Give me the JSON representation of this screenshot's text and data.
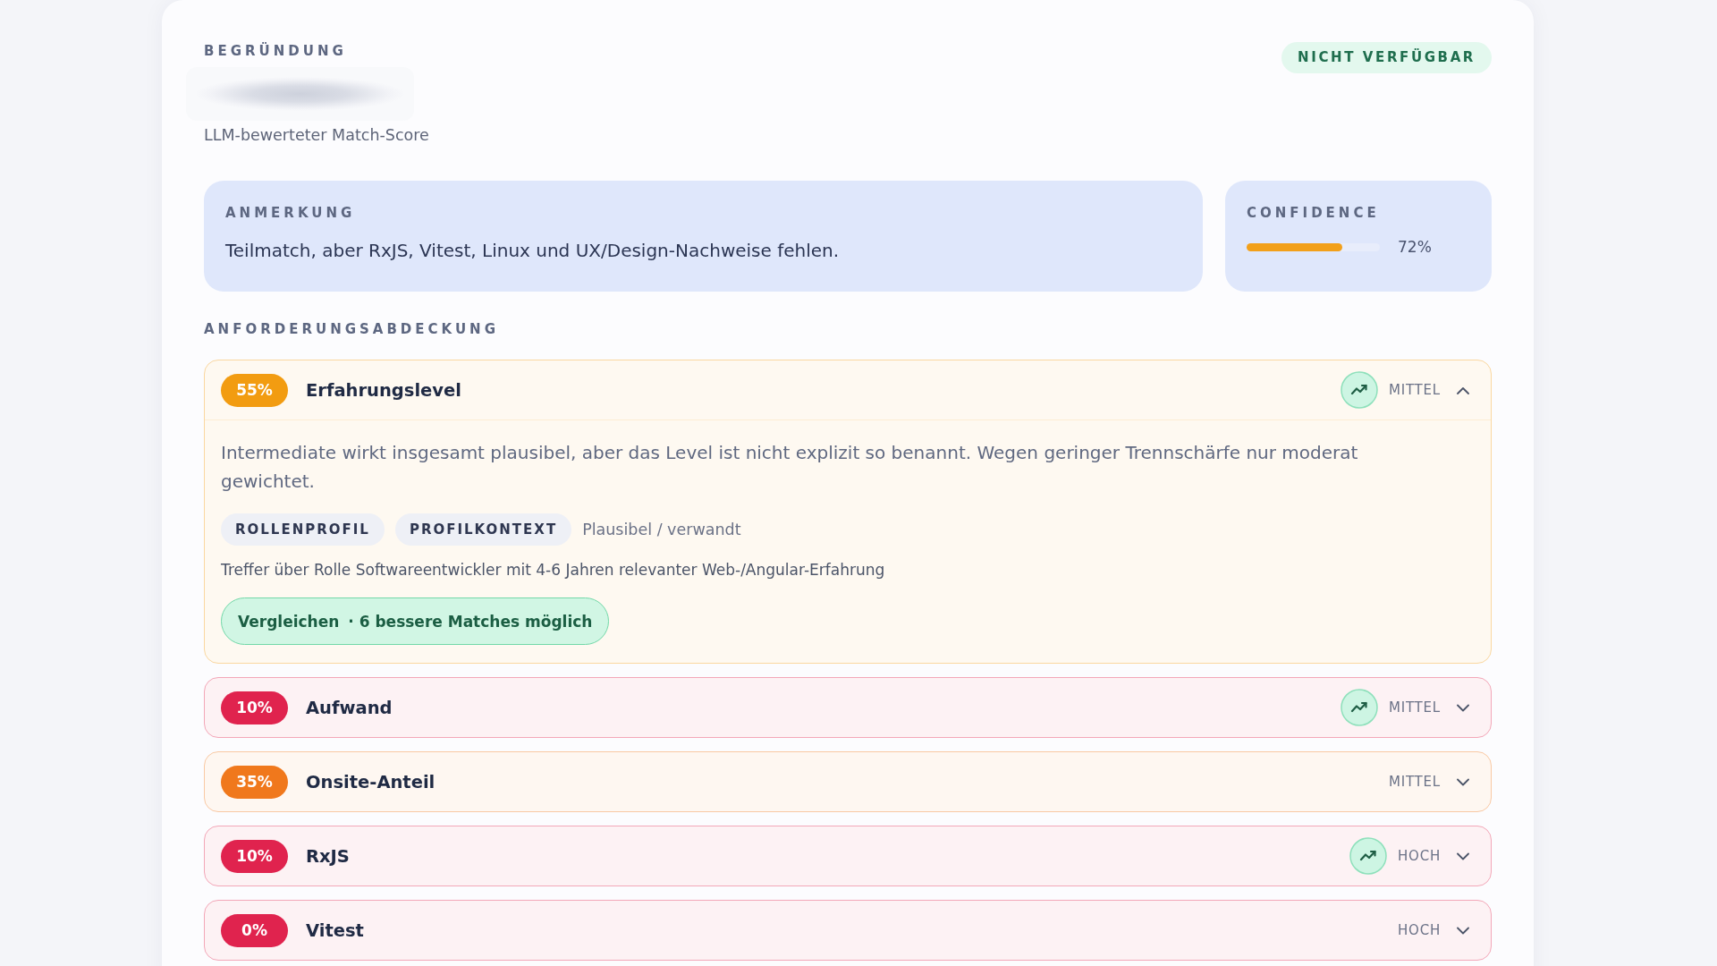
{
  "reasoning": {
    "label": "BEGRÜNDUNG",
    "subtitle": "LLM-bewerteter Match-Score"
  },
  "availability_badge": "NICHT VERFÜGBAR",
  "note": {
    "label": "ANMERKUNG",
    "text": "Teilmatch, aber RxJS, Vitest, Linux und UX/Design-Nachweise fehlen."
  },
  "confidence": {
    "label": "CONFIDENCE",
    "level": 0.72,
    "reading": "72%"
  },
  "requirements": {
    "title": "ANFORDERUNGSABDECKUNG",
    "items": [
      {
        "score": "55%",
        "color": "#f29c11",
        "name": "Erfahrungslevel",
        "trend": true,
        "priority": "MITTEL",
        "expanded": true,
        "details": {
          "text": "Intermediate wirkt insgesamt plausibel, aber das Level ist nicht explizit so benannt. Wegen geringer Trennschärfe nur moderat gewichtet.",
          "tags": [
            "ROLLENPROFIL",
            "PROFILKONTEXT"
          ],
          "tag_note": "Plausibel / verwandt",
          "evidence": "Treffer über Rolle Softwareentwickler mit 4-6 Jahren relevanter Web-/Angular-Erfahrung",
          "compare_button": {
            "label": "Vergleichen",
            "hint": "· 6 bessere Matches möglich"
          }
        }
      },
      {
        "score": "10%",
        "color": "#e0234e",
        "name": "Aufwand",
        "trend": true,
        "priority": "MITTEL",
        "expanded": false
      },
      {
        "score": "35%",
        "color": "#f0781c",
        "name": "Onsite-Anteil",
        "trend": false,
        "priority": "MITTEL",
        "expanded": false
      },
      {
        "score": "10%",
        "color": "#e0234e",
        "name": "RxJS",
        "trend": true,
        "priority": "HOCH",
        "expanded": false
      },
      {
        "score": "0%",
        "color": "#e0234e",
        "name": "Vitest",
        "trend": false,
        "priority": "HOCH",
        "expanded": false
      }
    ]
  }
}
